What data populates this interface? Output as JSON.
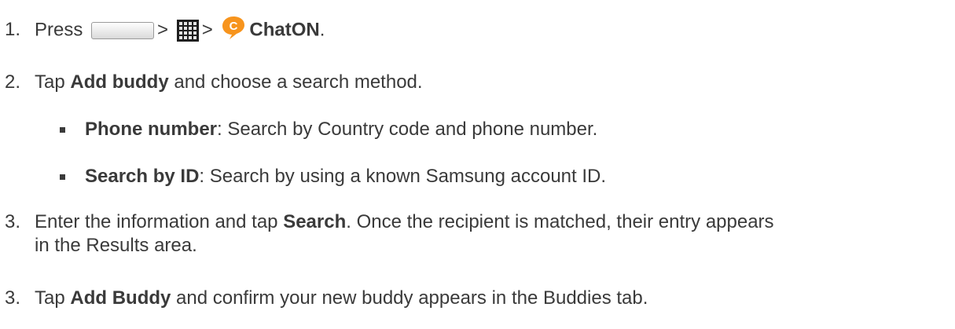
{
  "steps": [
    {
      "num": "1.",
      "pre": "Press",
      "sep1": ">",
      "sep2": ">",
      "app": "ChatON",
      "end": "."
    },
    {
      "num": "2.",
      "pre": "Tap ",
      "bold": "Add buddy",
      "post": " and choose a search method."
    },
    {
      "num": "3.",
      "pre": "Enter the information and tap ",
      "bold": "Search",
      "post": ". Once the recipient is matched, their entry appears",
      "cont": "in the Results area."
    },
    {
      "num": "3.",
      "pre": "Tap ",
      "bold": "Add Buddy",
      "post": " and confirm your new buddy appears in the Buddies tab."
    }
  ],
  "bullets": [
    {
      "bold": "Phone number",
      "post": ": Search by Country code and phone number."
    },
    {
      "bold": "Search by ID",
      "post": ": Search by using a known Samsung account ID."
    }
  ],
  "icons": {
    "home": "home-key-icon",
    "apps": "apps-grid-icon",
    "chaton": "chaton-app-icon",
    "chaton_letter": "C"
  },
  "colors": {
    "text": "#3a3a3a",
    "chaton_orange": "#f7941d"
  }
}
